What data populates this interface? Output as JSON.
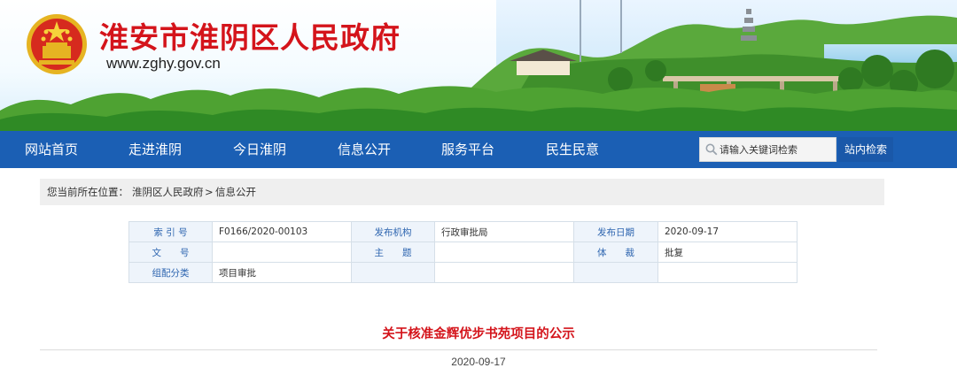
{
  "header": {
    "site_title": "淮安市淮阴区人民政府",
    "site_url": "www.zghy.gov.cn"
  },
  "nav": {
    "items": [
      "网站首页",
      "走进淮阴",
      "今日淮阴",
      "信息公开",
      "服务平台",
      "民生民意"
    ],
    "search_placeholder": "请输入关键词检索",
    "search_button": "站内检索"
  },
  "breadcrumb": {
    "prefix": "您当前所在位置：",
    "home": "淮阴区人民政府",
    "separator": ">",
    "current": "信息公开"
  },
  "info_table": {
    "index_label": "索 引 号",
    "index_value": "F0166/2020-00103",
    "publisher_label": "发布机构",
    "publisher_value": "行政审批局",
    "date_label": "发布日期",
    "date_value": "2020-09-17",
    "doc_no_label": "文　　号",
    "doc_no_value": "",
    "subject_label": "主　　题",
    "subject_value": "",
    "genre_label": "体　　裁",
    "genre_value": "批复",
    "category_label": "组配分类",
    "category_value": "项目审批"
  },
  "article": {
    "title": "关于核准金辉优步书苑项目的公示",
    "date": "2020-09-17"
  },
  "colors": {
    "nav_blue": "#1b5fb4",
    "title_red": "#d4141b",
    "label_blue": "#2f66b0"
  }
}
